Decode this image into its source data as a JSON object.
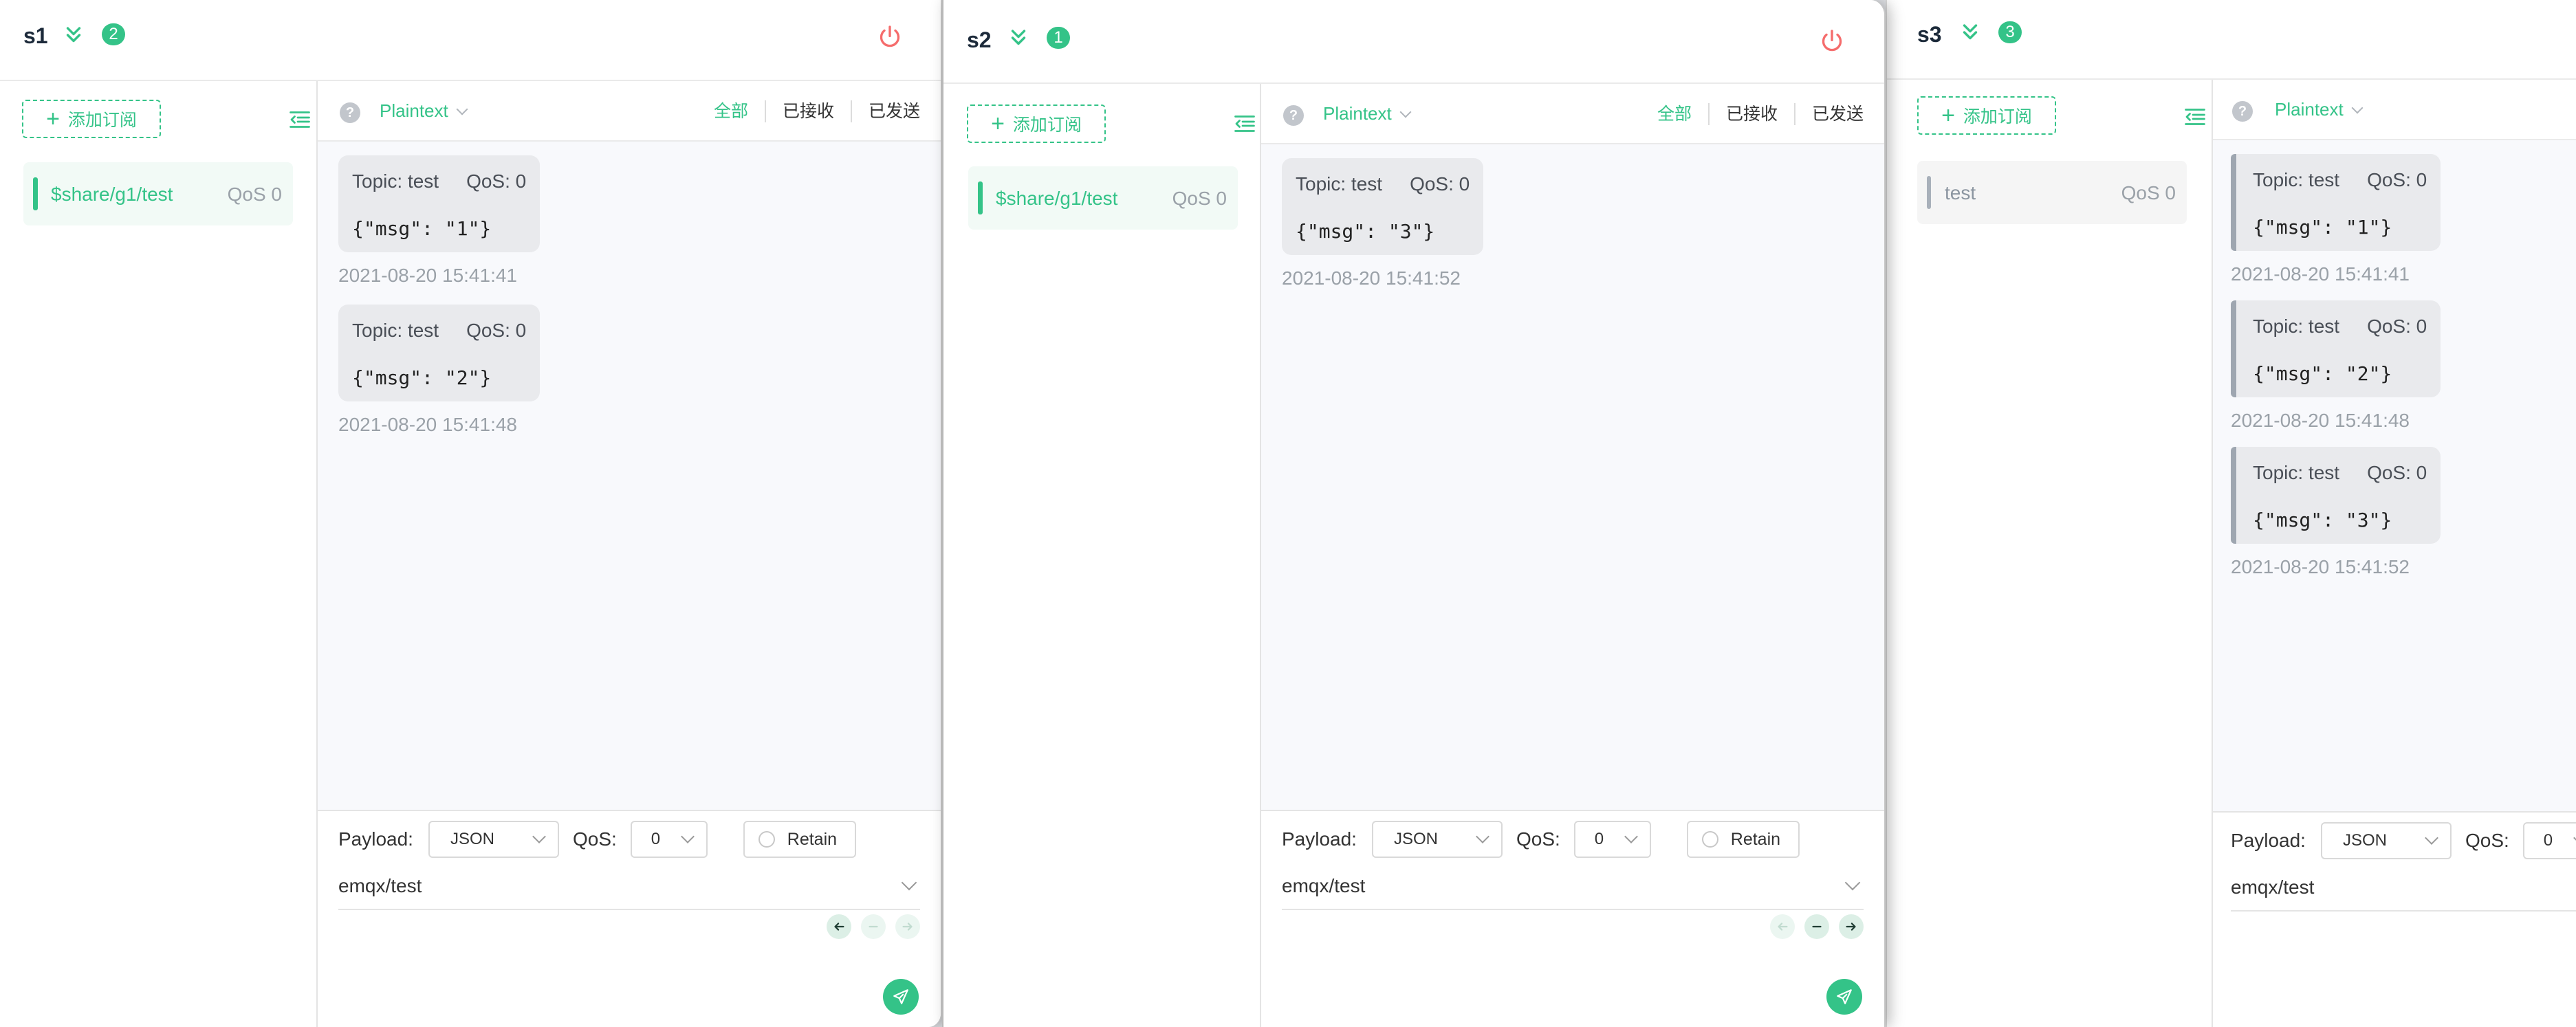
{
  "windows": [
    {
      "name": "s1",
      "badge": "2",
      "add_label": "添加订阅",
      "subscription": {
        "topic": "$share/g1/test",
        "qos": "QoS 0"
      },
      "payload_type": "Plaintext",
      "filters": [
        "全部",
        "已接收",
        "已发送"
      ],
      "messages": [
        {
          "topic": "Topic: test",
          "qos": "QoS: 0",
          "payload": "{\"msg\": \"1\"}",
          "time": "2021-08-20 15:41:41"
        },
        {
          "topic": "Topic: test",
          "qos": "QoS: 0",
          "payload": "{\"msg\": \"2\"}",
          "time": "2021-08-20 15:41:48"
        }
      ],
      "compose": {
        "payload_label": "Payload:",
        "payload_format": "JSON",
        "qos_label": "QoS:",
        "qos_value": "0",
        "retain_label": "Retain",
        "topic": "emqx/test"
      }
    },
    {
      "name": "s2",
      "badge": "1",
      "add_label": "添加订阅",
      "subscription": {
        "topic": "$share/g1/test",
        "qos": "QoS 0"
      },
      "payload_type": "Plaintext",
      "filters": [
        "全部",
        "已接收",
        "已发送"
      ],
      "messages": [
        {
          "topic": "Topic: test",
          "qos": "QoS: 0",
          "payload": "{\"msg\": \"3\"}",
          "time": "2021-08-20 15:41:52"
        }
      ],
      "compose": {
        "payload_label": "Payload:",
        "payload_format": "JSON",
        "qos_label": "QoS:",
        "qos_value": "0",
        "retain_label": "Retain",
        "topic": "emqx/test"
      }
    },
    {
      "name": "s3",
      "badge": "3",
      "add_label": "添加订阅",
      "subscription": {
        "topic": "test",
        "qos": "QoS 0"
      },
      "payload_type": "Plaintext",
      "messages": [
        {
          "topic": "Topic: test",
          "qos": "QoS: 0",
          "payload": "{\"msg\": \"1\"}",
          "time": "2021-08-20 15:41:41"
        },
        {
          "topic": "Topic: test",
          "qos": "QoS: 0",
          "payload": "{\"msg\": \"2\"}",
          "time": "2021-08-20 15:41:48"
        },
        {
          "topic": "Topic: test",
          "qos": "QoS: 0",
          "payload": "{\"msg\": \"3\"}",
          "time": "2021-08-20 15:41:52"
        }
      ],
      "compose": {
        "payload_label": "Payload:",
        "payload_format": "JSON",
        "qos_label": "QoS:",
        "qos_value": "0",
        "topic": "emqx/test"
      }
    }
  ],
  "help_glyph": "?",
  "icons": {
    "collapse": "chevron-double-down-icon",
    "disconnect": "power-icon",
    "sidebar_toggle": "indent-icon",
    "send": "send-icon",
    "history_prev": "arrow-left-icon",
    "history_current": "minus-icon",
    "history_next": "arrow-right-icon"
  },
  "colors": {
    "accent": "#34c388",
    "disconnect": "#f56c6c",
    "message_bg": "#e9eaed",
    "time": "#9aa1a8"
  }
}
